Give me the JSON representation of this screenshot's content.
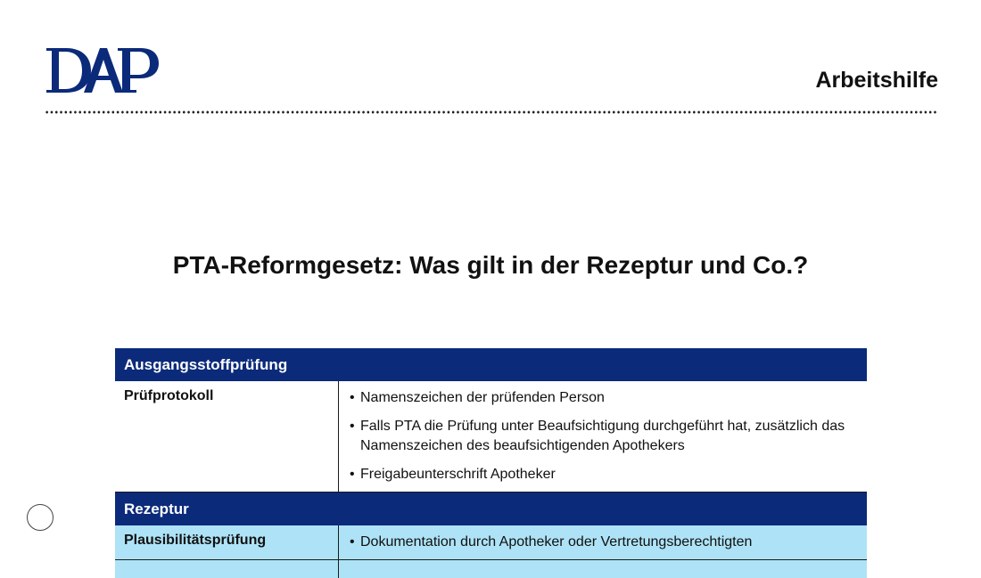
{
  "header": {
    "logo_text": "DAP",
    "doc_type": "Arbeitshilfe"
  },
  "title": "PTA-Reformgesetz: Was gilt in der Rezeptur und Co.?",
  "sections": [
    {
      "heading": "Ausgangsstoffprüfung",
      "rows": [
        {
          "key": "Prüfprotokoll",
          "items": [
            "Namenszeichen der prüfenden Person",
            "Falls PTA die Prüfung unter Beaufsichtigung durchgeführt hat, zusätzlich das Namenszeichen des beaufsichtigenden Apothekers",
            "Freigabeunterschrift Apotheker"
          ]
        }
      ]
    },
    {
      "heading": "Rezeptur",
      "rows": [
        {
          "key": "Plausibilitätsprüfung",
          "items": [
            "Dokumentation durch Apotheker oder Vertretungsberechtigten"
          ]
        }
      ]
    }
  ],
  "colors": {
    "header_blue": "#0b2a7a",
    "row_light_blue": "#aee3f7"
  }
}
